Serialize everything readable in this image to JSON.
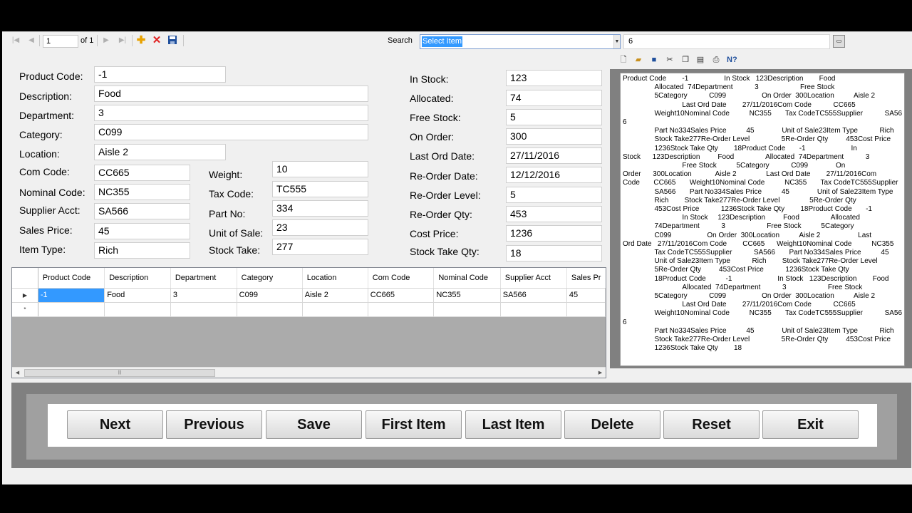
{
  "navigator": {
    "position": "1",
    "of_text": "of 1",
    "search_label": "Search",
    "search_selected": "Select Item",
    "search_value": "6"
  },
  "form": {
    "labels": {
      "product_code": "Product Code:",
      "description": "Description:",
      "department": "Department:",
      "category": "Category:",
      "location": "Location:",
      "com_code": "Com Code:",
      "nominal_code": "Nominal Code:",
      "supplier_acct": "Supplier Acct:",
      "sales_price": "Sales Price:",
      "item_type": "Item Type:",
      "weight": "Weight:",
      "tax_code": "Tax Code:",
      "part_no": "Part No:",
      "unit_of_sale": "Unit of Sale:",
      "stock_take": "Stock Take:",
      "in_stock": "In Stock:",
      "allocated": "Allocated:",
      "free_stock": "Free Stock:",
      "on_order": "On Order:",
      "last_ord_date": "Last Ord Date:",
      "reorder_date": "Re-Order Date:",
      "reorder_level": "Re-Order Level:",
      "reorder_qty": "Re-Order Qty:",
      "cost_price": "Cost Price:",
      "stock_take_qty": "Stock Take Qty:"
    },
    "values": {
      "product_code": "-1",
      "description": "Food",
      "department": "3",
      "category": "C099",
      "location": "Aisle 2",
      "com_code": "CC665",
      "nominal_code": "NC355",
      "supplier_acct": "SA566",
      "sales_price": "45",
      "item_type": "Rich",
      "weight": "10",
      "tax_code": "TC555",
      "part_no": "334",
      "unit_of_sale": "23",
      "stock_take": "277",
      "in_stock": "123",
      "allocated": "74",
      "free_stock": "5",
      "on_order": "300",
      "last_ord_date": "27/11/2016",
      "reorder_date": "12/12/2016",
      "reorder_level": "5",
      "reorder_qty": "453",
      "cost_price": "1236",
      "stock_take_qty": "18"
    }
  },
  "grid": {
    "columns": [
      "Product Code",
      "Description",
      "Department",
      "Category",
      "Location",
      "Com Code",
      "Nominal Code",
      "Supplier Acct",
      "Sales Pr"
    ],
    "row": [
      "-1",
      "Food",
      "3",
      "C099",
      "Aisle 2",
      "CC665",
      "NC355",
      "SA566",
      "45"
    ],
    "new_row_marker": "*",
    "current_row_marker": "▶"
  },
  "report": {
    "text": "Product Code        -1                  In Stock   123Description        Food\n                Allocated  74Department           3                     Free Stock\n                5Category           C099                  On Order  300Location          Aisle 2\n                              Last Ord Date        27/11/2016Com Code           CC665\n                Weight10Nominal Code          NC355       Tax CodeTC555Supplier           SA566\n                Part No334Sales Price          45              Unit of Sale23Item Type           Rich\n                Stock Take277Re-Order Level                5Re-Order Qty         453Cost Price\n                1236Stock Take Qty        18Product Code       -1                       In\nStock      123Description         Food                Allocated  74Department           3\n                              Free Stock          5Category           C099              On\nOrder      300Location            Aisle 2               Last Ord Date        27/11/2016Com\nCode       CC665       Weight10Nominal Code          NC355       Tax CodeTC555Supplier\n                SA566       Part No334Sales Price          45              Unit of Sale23Item Type\n                Rich        Stock Take277Re-Order Level               5Re-Order Qty\n                453Cost Price           1236Stock Take Qty        18Product Code       -1\n                              In Stock     123Description         Food                Allocated\n                74Department           3                     Free Stock          5Category\n                C099                  On Order  300Location          Aisle 2                   Last\nOrd Date   27/11/2016Com Code        CC665      Weight10Nominal Code          NC355\n                Tax CodeTC555Supplier           SA566       Part No334Sales Price          45\n                Unit of Sale23Item Type           Rich        Stock Take277Re-Order Level\n                5Re-Order Qty         453Cost Price           1236Stock Take Qty\n                18Product Code          -1                       In Stock   123Description        Food\n                              Allocated  74Department           3                     Free Stock\n                5Category           C099                  On Order  300Location          Aisle 2\n                              Last Ord Date        27/11/2016Com Code           CC665\n                Weight10Nominal Code          NC355       Tax CodeTC555Supplier           SA566\n                Part No334Sales Price          45              Unit of Sale23Item Type           Rich\n                Stock Take277Re-Order Level                5Re-Order Qty         453Cost Price\n                1236Stock Take Qty        18"
  },
  "buttons": {
    "next": "Next",
    "previous": "Previous",
    "save": "Save",
    "first_item": "First Item",
    "last_item": "Last Item",
    "delete": "Delete",
    "reset": "Reset",
    "exit": "Exit"
  },
  "colors": {
    "selection": "#3399ff",
    "add_icon": "#e8a200",
    "delete_icon": "#e02020",
    "save_icon": "#1f4f9c"
  },
  "icons": {
    "navigator": [
      "move-first-icon",
      "move-previous-icon",
      "move-next-icon",
      "move-last-icon",
      "add-new-icon",
      "delete-icon",
      "save-icon"
    ],
    "report_toolbar": [
      "new-icon",
      "open-icon",
      "save-icon",
      "cut-icon",
      "copy-icon",
      "paste-icon",
      "print-icon",
      "help-icon"
    ]
  }
}
